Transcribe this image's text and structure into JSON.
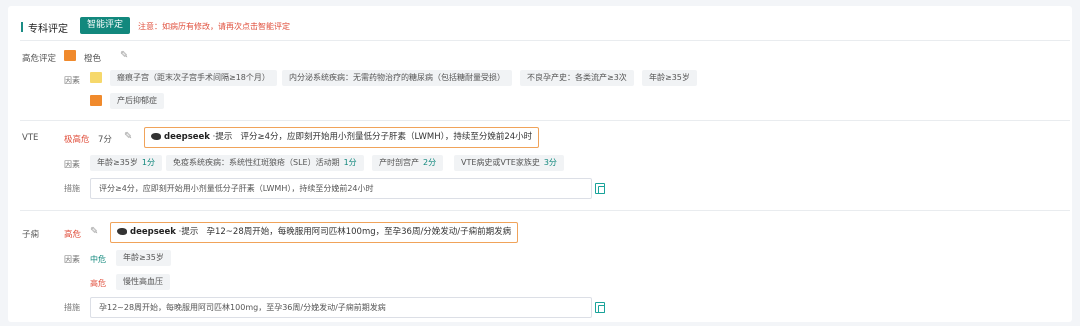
{
  "header": {
    "title": "专科评定",
    "smart_button": "智能评定",
    "warning": "注意：如病历有修改，请再次点击智能评定"
  },
  "high_risk": {
    "label": "高危评定",
    "level": "橙色",
    "level_color": "#f08a2c",
    "factors_label": "因素",
    "factors_row1": [
      "瘢痕子宫（距末次子宫手术间隔≥18个月）",
      "内分泌系统疾病：无需药物治疗的糖尿病（包括糖耐量受损）",
      "不良孕产史：各类流产≥3次",
      "年龄≥35岁"
    ],
    "factors_row1_color": "#f6d86b",
    "factors_row2": [
      "产后抑郁症"
    ],
    "factors_row2_color": "#f08a2c"
  },
  "vte": {
    "label": "VTE",
    "risk": "极高危",
    "score": "7分",
    "deepseek_brand": "deepseek",
    "deepseek_tag": "·提示",
    "deepseek_text": "评分≥4分，应即刻开始用小剂量低分子肝素（LWMH），持续至分娩前24小时",
    "factors_label": "因素",
    "factors": [
      {
        "name": "年龄≥35岁",
        "score": "1分"
      },
      {
        "name": "免疫系统疾病：系统性红斑狼疮（SLE）活动期",
        "score": "1分"
      },
      {
        "name": "产时剖宫产",
        "score": "2分"
      },
      {
        "name": "VTE病史或VTE家族史",
        "score": "3分"
      }
    ],
    "measures_label": "措施",
    "measures": "评分≥4分，应即刻开始用小剂量低分子肝素（LWMH），持续至分娩前24小时"
  },
  "preeclampsia": {
    "label": "子痫",
    "risk": "高危",
    "deepseek_brand": "deepseek",
    "deepseek_tag": "·提示",
    "deepseek_text": "孕12~28周开始，每晚服用阿司匹林100mg，至孕36周/分娩发动/子痫前期发病",
    "factors_label": "因素",
    "mid_label": "中危",
    "mid_factors": [
      "年龄≥35岁"
    ],
    "high_label": "高危",
    "high_factors": [
      "慢性高血压"
    ],
    "measures_label": "措施",
    "measures": "孕12~28周开始，每晚服用阿司匹林100mg，至孕36周/分娩发动/子痫前期发病"
  }
}
